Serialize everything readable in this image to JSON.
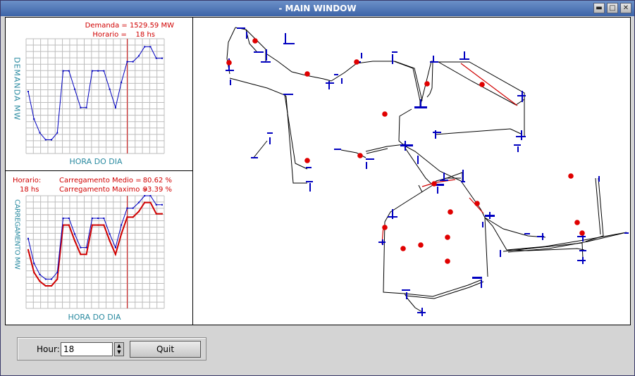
{
  "window": {
    "title": "- MAIN WINDOW"
  },
  "demand_panel": {
    "demand_text": "Demanda = 1529.59 MW",
    "hour_text": "Horario =    18 hs",
    "ylabel": "DEMANDA  MW",
    "xlabel": "HORA DO DIA"
  },
  "load_panel": {
    "hour_label": "Horario:",
    "hour_value": "18 hs",
    "avg_label": "Carregamento Medio =",
    "avg_value": "80.62 %",
    "max_label": "Carregamento Maximo =",
    "max_value": "93.39 %",
    "ylabel": "CARREGAMENTO  MW",
    "xlabel": "HORA DO DIA"
  },
  "controls": {
    "hour_label": "Hour:",
    "hour_value": "18",
    "quit_label": "Quit"
  },
  "colors": {
    "blue": "#0000c0",
    "red": "#d00000",
    "teal": "#2a8aa0",
    "grid": "#bdbdbd"
  },
  "chart_data": [
    {
      "type": "line",
      "x": [
        1,
        2,
        3,
        4,
        5,
        6,
        7,
        8,
        9,
        10,
        11,
        12,
        13,
        14,
        15,
        16,
        17,
        18,
        19,
        20,
        21,
        22,
        23,
        24
      ],
      "series": [
        {
          "values": [
            0.46,
            0.7,
            0.82,
            0.88,
            0.88,
            0.82,
            0.28,
            0.28,
            0.44,
            0.6,
            0.6,
            0.28,
            0.28,
            0.28,
            0.44,
            0.6,
            0.38,
            0.2,
            0.2,
            0.15,
            0.07,
            0.07,
            0.17,
            0.17
          ]
        }
      ],
      "marker_hour": 18,
      "ylim": [
        0,
        1
      ],
      "xlabel": "HORA DO DIA",
      "ylabel": "DEMANDA  MW"
    },
    {
      "type": "line",
      "x": [
        1,
        2,
        3,
        4,
        5,
        6,
        7,
        8,
        9,
        10,
        11,
        12,
        13,
        14,
        15,
        16,
        17,
        18,
        19,
        20,
        21,
        22,
        23,
        24
      ],
      "series": [
        {
          "values": [
            0.48,
            0.68,
            0.76,
            0.8,
            0.8,
            0.74,
            0.26,
            0.26,
            0.4,
            0.52,
            0.52,
            0.26,
            0.26,
            0.26,
            0.4,
            0.52,
            0.34,
            0.19,
            0.19,
            0.14,
            0.06,
            0.06,
            0.16,
            0.16
          ]
        },
        {
          "values": [
            0.38,
            0.6,
            0.7,
            0.74,
            0.74,
            0.68,
            0.2,
            0.2,
            0.34,
            0.46,
            0.46,
            0.2,
            0.2,
            0.2,
            0.34,
            0.46,
            0.26,
            0.11,
            0.11,
            0.06,
            0.0,
            0.0,
            0.08,
            0.08
          ]
        }
      ],
      "marker_hour": 18,
      "ylim": [
        0,
        1
      ],
      "xlabel": "HORA DO DIA",
      "ylabel": "CARREGAMENTO  MW"
    }
  ]
}
